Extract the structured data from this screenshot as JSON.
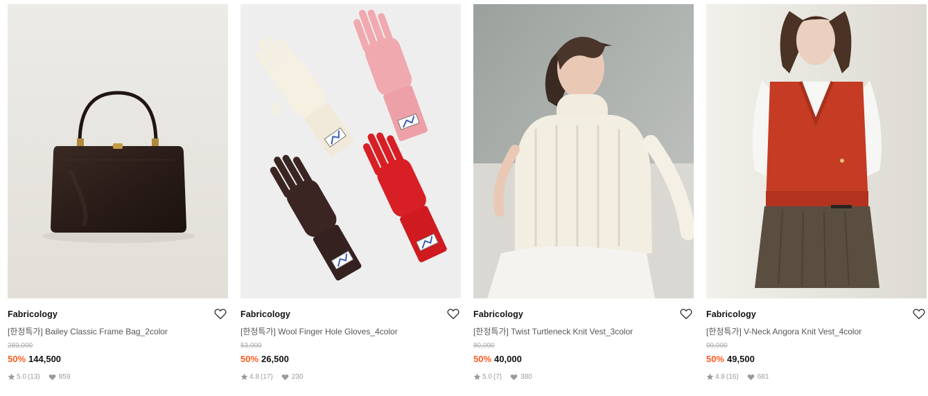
{
  "colors": {
    "discount": "#ff5a1f",
    "meta": "#9a9a9a",
    "strike": "#aaaaaa"
  },
  "icons": {
    "wishlist": "heart-outline-icon",
    "rating": "star-icon",
    "likes": "heart-filled-icon"
  },
  "products": [
    {
      "brand": "Fabricology",
      "name": "[한정특가] Bailey Classic Frame Bag_2color",
      "original_price": "289,000",
      "discount": "50%",
      "price": "144,500",
      "rating": "5.0",
      "reviews": "(13)",
      "likes": "859"
    },
    {
      "brand": "Fabricology",
      "name": "[한정특가] Wool Finger Hole Gloves_4color",
      "original_price": "53,000",
      "discount": "50%",
      "price": "26,500",
      "rating": "4.8",
      "reviews": "(17)",
      "likes": "230"
    },
    {
      "brand": "Fabricology",
      "name": "[한정특가] Twist Turtleneck Knit Vest_3color",
      "original_price": "80,000",
      "discount": "50%",
      "price": "40,000",
      "rating": "5.0",
      "reviews": "(7)",
      "likes": "380"
    },
    {
      "brand": "Fabricology",
      "name": "[한정특가] V-Neck Angora Knit Vest_4color",
      "original_price": "99,000",
      "discount": "50%",
      "price": "49,500",
      "rating": "4.8",
      "reviews": "(16)",
      "likes": "681"
    }
  ]
}
